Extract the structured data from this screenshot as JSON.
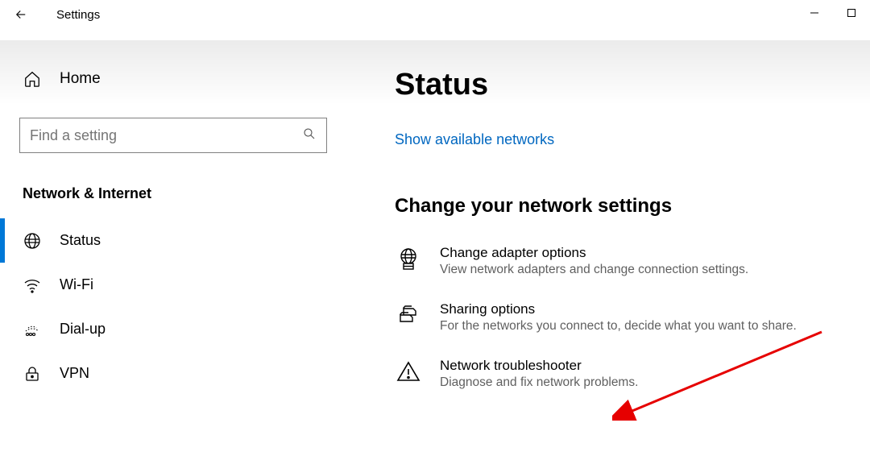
{
  "titlebar": {
    "app_title": "Settings"
  },
  "sidebar": {
    "home_label": "Home",
    "search_placeholder": "Find a setting",
    "category_label": "Network & Internet",
    "items": [
      {
        "label": "Status"
      },
      {
        "label": "Wi-Fi"
      },
      {
        "label": "Dial-up"
      },
      {
        "label": "VPN"
      }
    ]
  },
  "content": {
    "heading": "Status",
    "link_label": "Show available networks",
    "subheading": "Change your network settings",
    "cards": [
      {
        "title": "Change adapter options",
        "desc": "View network adapters and change connection settings."
      },
      {
        "title": "Sharing options",
        "desc": "For the networks you connect to, decide what you want to share."
      },
      {
        "title": "Network troubleshooter",
        "desc": "Diagnose and fix network problems."
      }
    ]
  }
}
